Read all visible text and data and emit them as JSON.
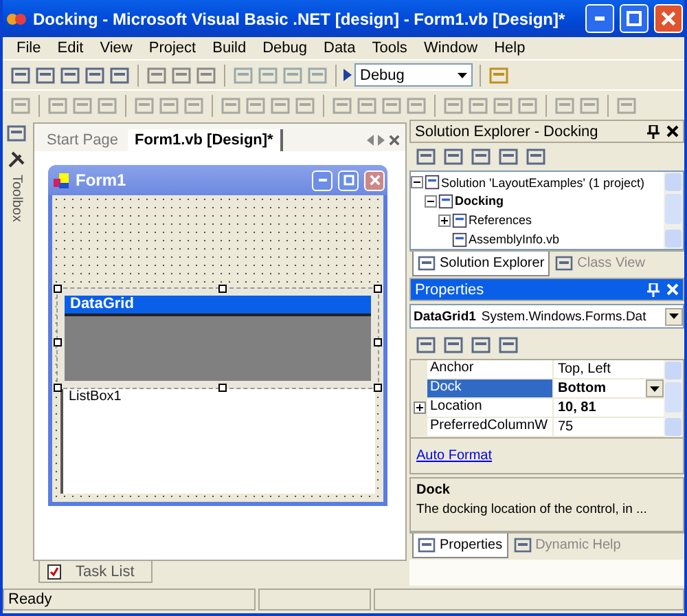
{
  "window": {
    "title": "Docking - Microsoft Visual Basic .NET [design] - Form1.vb [Design]*"
  },
  "menu": [
    "File",
    "Edit",
    "View",
    "Project",
    "Build",
    "Debug",
    "Data",
    "Tools",
    "Window",
    "Help"
  ],
  "toolbar": {
    "configuration": "Debug"
  },
  "toolbox": {
    "label": "Toolbox"
  },
  "document_tabs": [
    {
      "label": "Start Page",
      "selected": false
    },
    {
      "label": "Form1.vb [Design]*",
      "selected": true
    }
  ],
  "form": {
    "title": "Form1",
    "datagrid_caption": "DataGrid",
    "listbox_label": "ListBox1"
  },
  "bottom_tabs": [
    {
      "label": "Task List",
      "selected": true
    }
  ],
  "solution_explorer": {
    "title": "Solution Explorer - Docking",
    "active": false,
    "tree": [
      {
        "label": "Solution 'LayoutExamples' (1 project)",
        "bold": false,
        "expanded": true,
        "children": [
          {
            "label": "Docking",
            "bold": true,
            "expanded": true,
            "children": [
              {
                "label": "References",
                "bold": false,
                "expanded": false
              },
              {
                "label": "AssemblyInfo.vb",
                "bold": false
              }
            ]
          }
        ]
      }
    ],
    "tabs": [
      {
        "label": "Solution Explorer",
        "selected": true
      },
      {
        "label": "Class View",
        "selected": false
      }
    ]
  },
  "properties": {
    "title": "Properties",
    "active": true,
    "object_name": "DataGrid1",
    "object_type": "System.Windows.Forms.Dat",
    "rows": [
      {
        "name": "Anchor",
        "value": "Top, Left",
        "selected": false,
        "bold": false,
        "expandable": false
      },
      {
        "name": "Dock",
        "value": "Bottom",
        "selected": true,
        "bold": true,
        "expandable": false
      },
      {
        "name": "Location",
        "value": "10, 81",
        "selected": false,
        "bold": true,
        "expandable": true
      },
      {
        "name": "PreferredColumnW",
        "value": "75",
        "selected": false,
        "bold": false,
        "expandable": false
      }
    ],
    "command": "Auto Format",
    "description": {
      "title": "Dock",
      "text": "The docking location of the control, in ..."
    },
    "tabs": [
      {
        "label": "Properties",
        "selected": true
      },
      {
        "label": "Dynamic Help",
        "selected": false
      }
    ]
  },
  "status_bar": {
    "text": "Ready"
  }
}
